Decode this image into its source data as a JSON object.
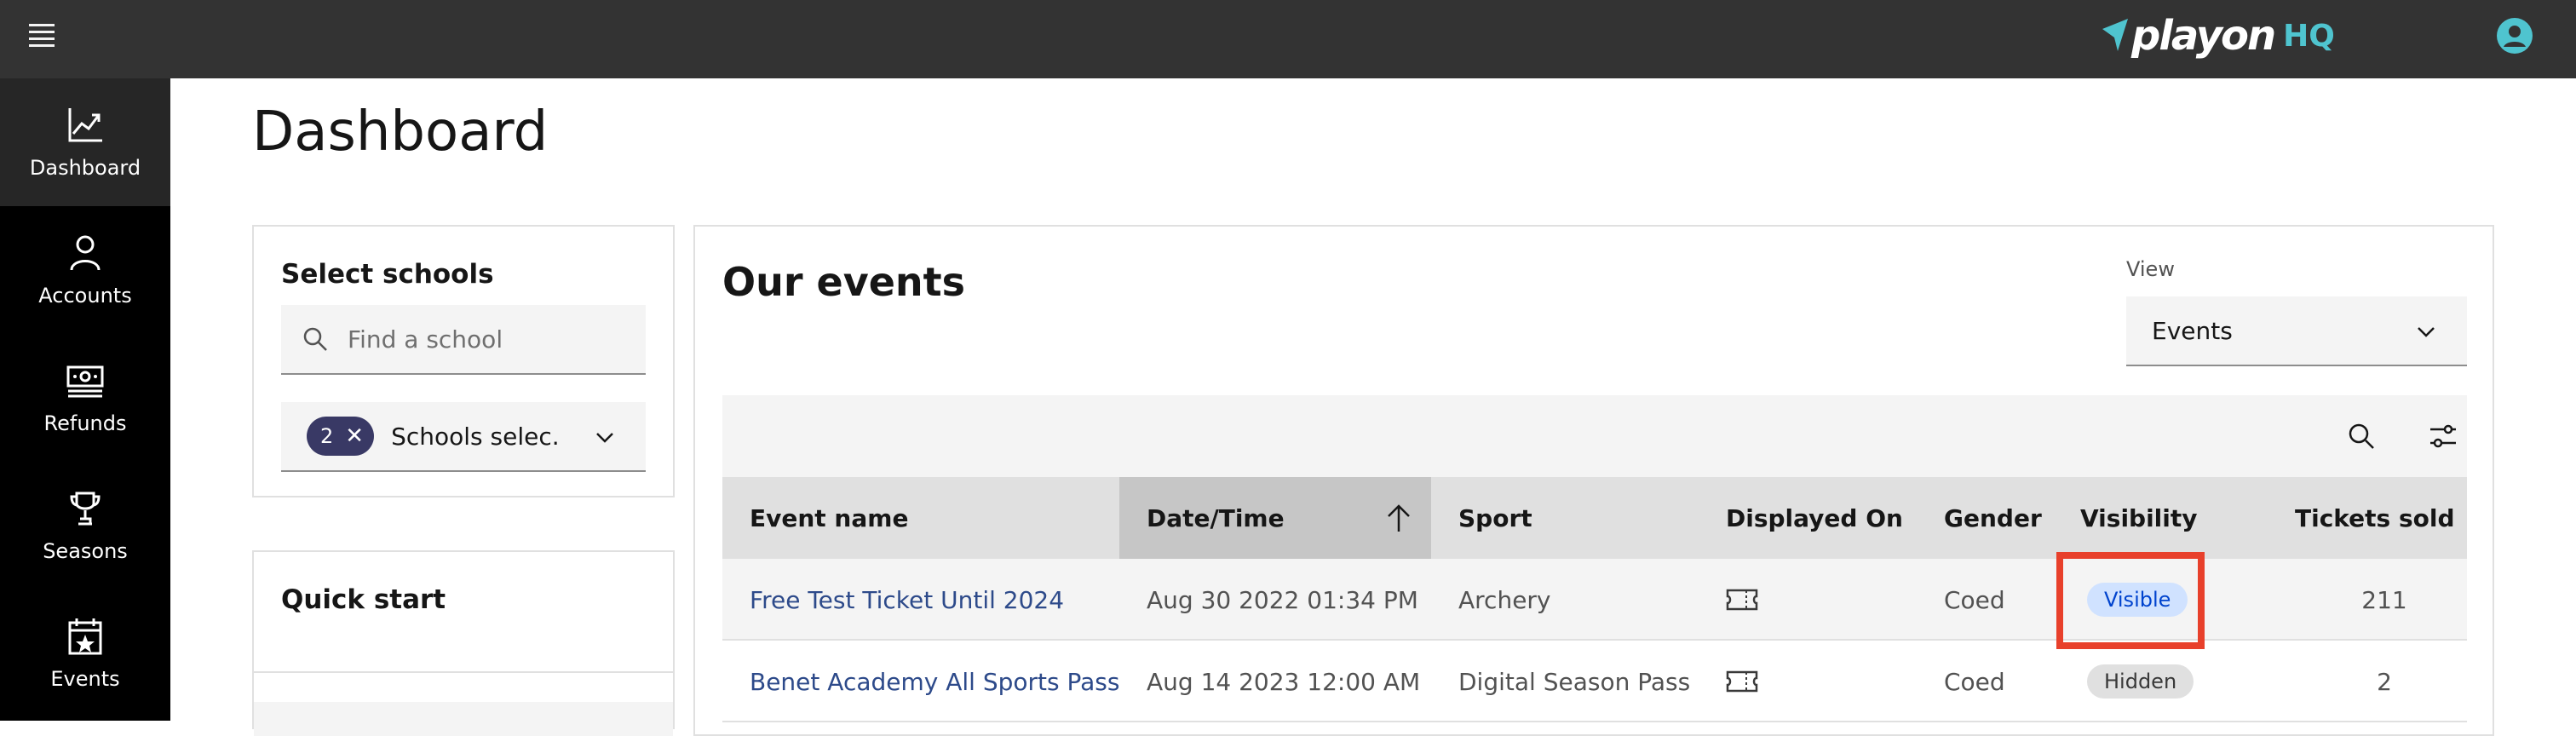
{
  "topbar": {
    "logo_text": "playon",
    "logo_suffix": "HQ",
    "icons": [
      "menu-icon",
      "user-account-icon"
    ]
  },
  "sidebar": {
    "items": [
      {
        "label": "Dashboard",
        "icon": "chart-line-icon",
        "active": true
      },
      {
        "label": "Accounts",
        "icon": "user-icon",
        "active": false
      },
      {
        "label": "Refunds",
        "icon": "money-icon",
        "active": false
      },
      {
        "label": "Seasons",
        "icon": "trophy-icon",
        "active": false
      },
      {
        "label": "Events",
        "icon": "calendar-star-icon",
        "active": false
      }
    ]
  },
  "page": {
    "title": "Dashboard"
  },
  "schools": {
    "title": "Select schools",
    "search_placeholder": "Find a school",
    "selected_count": "2",
    "selected_text": "Schools selec..."
  },
  "quick_start": {
    "title": "Quick start"
  },
  "events": {
    "title": "Our events",
    "view_label": "View",
    "view_value": "Events",
    "columns": [
      "Event name",
      "Date/Time",
      "Sport",
      "Displayed On",
      "Gender",
      "Visibility",
      "Tickets sold"
    ],
    "rows": [
      {
        "name": "Free Test Ticket Until 2024",
        "datetime": "Aug 30 2022 01:34 PM",
        "sport": "Archery",
        "displayed_on": "ticket-icon",
        "gender": "Coed",
        "visibility": "Visible",
        "tickets": "211"
      },
      {
        "name": "Benet Academy All Sports Pass",
        "datetime": "Aug 14 2023 12:00 AM",
        "sport": "Digital Season Pass",
        "displayed_on": "ticket-icon",
        "gender": "Coed",
        "visibility": "Hidden",
        "tickets": "2"
      }
    ]
  },
  "colors": {
    "topbar": "#333333",
    "sidebar": "#000000",
    "accent": "#4fc4cf",
    "highlight": "#e8402b"
  }
}
